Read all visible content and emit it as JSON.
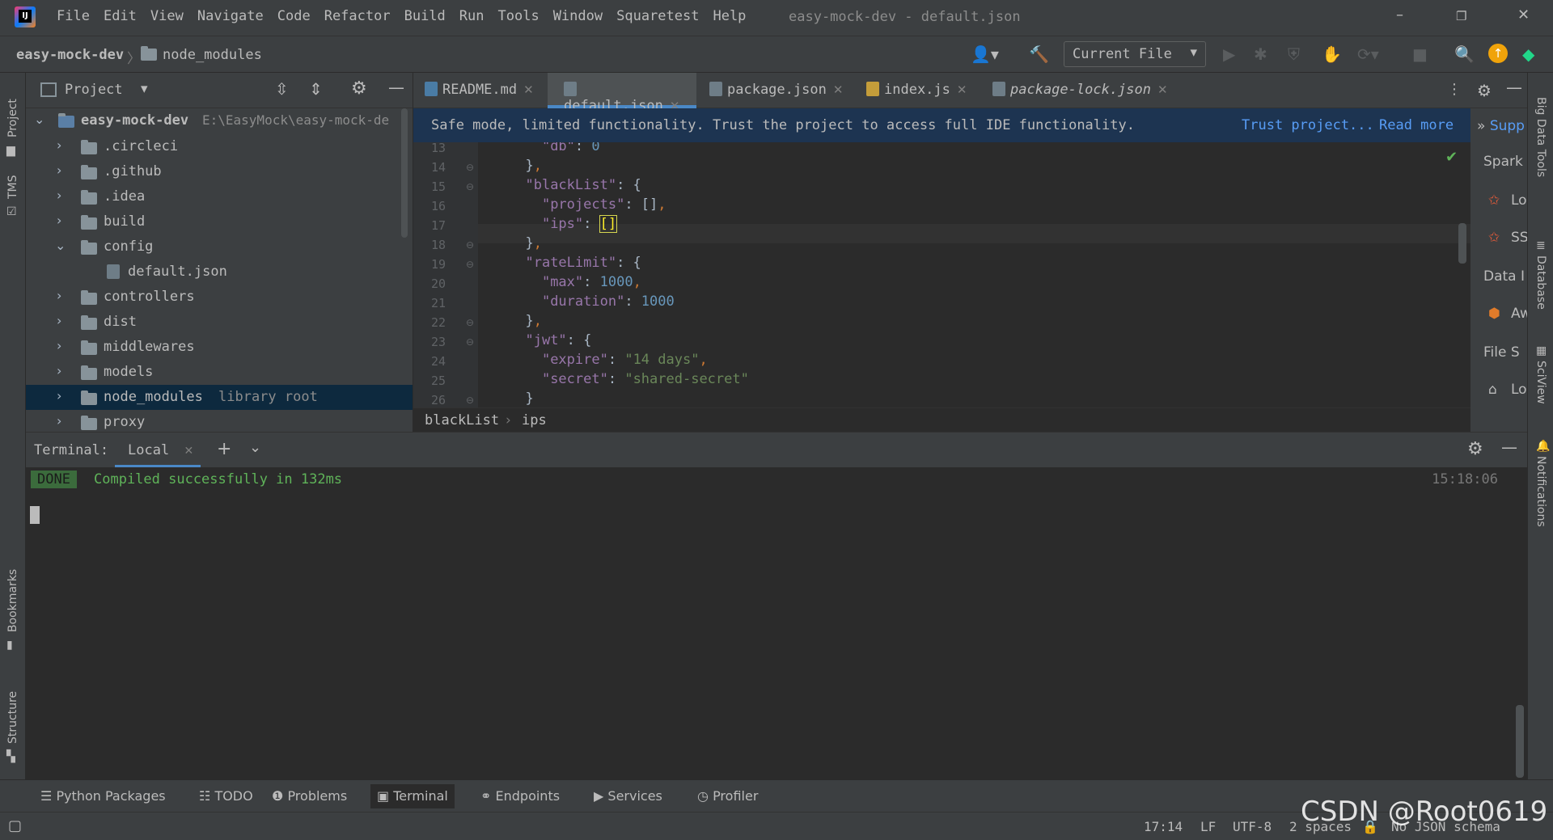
{
  "window": {
    "title": "easy-mock-dev - default.json",
    "menu": [
      "File",
      "Edit",
      "View",
      "Navigate",
      "Code",
      "Refactor",
      "Build",
      "Run",
      "Tools",
      "Window",
      "Squaretest",
      "Help"
    ]
  },
  "navbar": {
    "crumbs": [
      "easy-mock-dev",
      "node_modules"
    ],
    "run_config": "Current File"
  },
  "project_panel": {
    "title": "Project",
    "root_name": "easy-mock-dev",
    "root_path": "E:\\EasyMock\\easy-mock-de",
    "items": [
      {
        "label": ".circleci",
        "type": "folder",
        "expanded": false
      },
      {
        "label": ".github",
        "type": "folder",
        "expanded": false
      },
      {
        "label": ".idea",
        "type": "folder",
        "expanded": false
      },
      {
        "label": "build",
        "type": "folder",
        "expanded": false
      },
      {
        "label": "config",
        "type": "folder",
        "expanded": true
      },
      {
        "label": "default.json",
        "type": "file"
      },
      {
        "label": "controllers",
        "type": "folder",
        "expanded": false
      },
      {
        "label": "dist",
        "type": "folder",
        "expanded": false
      },
      {
        "label": "middlewares",
        "type": "folder",
        "expanded": false
      },
      {
        "label": "models",
        "type": "folder",
        "expanded": false
      },
      {
        "label": "node_modules",
        "type": "folder",
        "expanded": false,
        "note": "library root",
        "selected": true
      },
      {
        "label": "proxy",
        "type": "folder",
        "expanded": false
      }
    ]
  },
  "tabs": [
    {
      "label": "README.md",
      "icon": "markdown-file-icon"
    },
    {
      "label": "default.json",
      "icon": "json-file-icon",
      "active": true
    },
    {
      "label": "package.json",
      "icon": "json-file-icon"
    },
    {
      "label": "index.js",
      "icon": "js-file-icon"
    },
    {
      "label": "package-lock.json",
      "icon": "json-file-icon"
    }
  ],
  "banner": {
    "message": "Safe mode, limited functionality. Trust the project to access full IDE functionality.",
    "trust_link": "Trust project...",
    "read_more_link": "Read more"
  },
  "editor": {
    "lines": [
      {
        "n": "13",
        "indent": "    ",
        "parts": [
          [
            "k",
            "\"db\""
          ],
          [
            "b",
            ": "
          ],
          [
            "n",
            "0"
          ]
        ]
      },
      {
        "n": "14",
        "indent": "  ",
        "parts": [
          [
            "b",
            "}"
          ],
          [
            "p",
            ","
          ]
        ]
      },
      {
        "n": "15",
        "indent": "  ",
        "parts": [
          [
            "k",
            "\"blackList\""
          ],
          [
            "b",
            ": {"
          ]
        ]
      },
      {
        "n": "16",
        "indent": "    ",
        "parts": [
          [
            "k",
            "\"projects\""
          ],
          [
            "b",
            ": []"
          ],
          [
            "p",
            ","
          ]
        ]
      },
      {
        "n": "17",
        "indent": "    ",
        "parts": [
          [
            "k",
            "\"ips\""
          ],
          [
            "b",
            ": "
          ],
          [
            "b",
            "[]"
          ]
        ]
      },
      {
        "n": "18",
        "indent": "  ",
        "parts": [
          [
            "b",
            "}"
          ],
          [
            "p",
            ","
          ]
        ]
      },
      {
        "n": "19",
        "indent": "  ",
        "parts": [
          [
            "k",
            "\"rateLimit\""
          ],
          [
            "b",
            ": {"
          ]
        ]
      },
      {
        "n": "20",
        "indent": "    ",
        "parts": [
          [
            "k",
            "\"max\""
          ],
          [
            "b",
            ": "
          ],
          [
            "n",
            "1000"
          ],
          [
            "p",
            ","
          ]
        ]
      },
      {
        "n": "21",
        "indent": "    ",
        "parts": [
          [
            "k",
            "\"duration\""
          ],
          [
            "b",
            ": "
          ],
          [
            "n",
            "1000"
          ]
        ]
      },
      {
        "n": "22",
        "indent": "  ",
        "parts": [
          [
            "b",
            "}"
          ],
          [
            "p",
            ","
          ]
        ]
      },
      {
        "n": "23",
        "indent": "  ",
        "parts": [
          [
            "k",
            "\"jwt\""
          ],
          [
            "b",
            ": {"
          ]
        ]
      },
      {
        "n": "24",
        "indent": "    ",
        "parts": [
          [
            "k",
            "\"expire\""
          ],
          [
            "b",
            ": "
          ],
          [
            "s",
            "\"14 days\""
          ],
          [
            "p",
            ","
          ]
        ]
      },
      {
        "n": "25",
        "indent": "    ",
        "parts": [
          [
            "k",
            "\"secret\""
          ],
          [
            "b",
            ": "
          ],
          [
            "s",
            "\"shared-secret\""
          ]
        ]
      },
      {
        "n": "26",
        "indent": "  ",
        "parts": [
          [
            "b",
            "}"
          ]
        ]
      }
    ],
    "breadcrumb": [
      "blackList",
      "ips"
    ]
  },
  "big_data_tools": {
    "header": "Supp",
    "items": [
      "Spark",
      "Lo",
      "SS",
      "Data I",
      "Aw",
      "File S",
      "Lo"
    ]
  },
  "right_stripe": [
    "Big Data Tools",
    "Database",
    "SciView",
    "Notifications"
  ],
  "left_stripe": [
    "Project",
    "TMS",
    "Bookmarks",
    "Structure"
  ],
  "terminal": {
    "label": "Terminal:",
    "tab": "Local",
    "badge": "DONE",
    "message": "Compiled successfully in 132ms",
    "time": "15:18:06"
  },
  "tool_tabs": [
    "Python Packages",
    "TODO",
    "Problems",
    "Terminal",
    "Endpoints",
    "Services",
    "Profiler"
  ],
  "statusbar": {
    "position": "17:14",
    "line_sep": "LF",
    "encoding": "UTF-8",
    "indent": "2 spaces",
    "schema": "No JSON schema"
  },
  "watermark": "CSDN @Root0619"
}
